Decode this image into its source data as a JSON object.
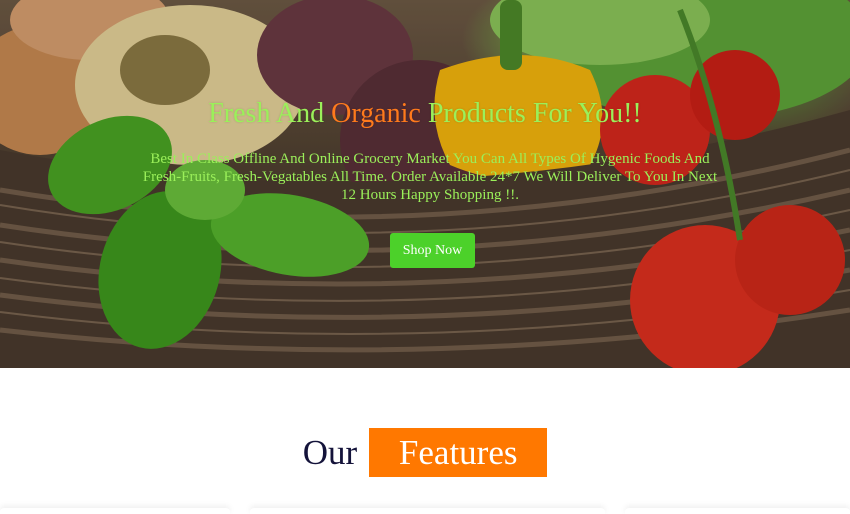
{
  "hero": {
    "title_part1": "Fresh And ",
    "title_accent": "Organic",
    "title_part2": " Products For You!!",
    "subtitle": "Best In Class Offline And Online Grocery Market You Can All Types Of Hygenic Foods And Fresh-Fruits, Fresh-Vegatables All Time. Order Available 24*7 We Will Deliver To You In Next 12 Hours Happy Shopping !!.",
    "button_label": "Shop Now"
  },
  "features": {
    "heading_word1": "Our",
    "heading_word2": "Features"
  },
  "colors": {
    "title_green": "#9bf05a",
    "accent_orange": "#ff7a1c",
    "button_green": "#4cd12a",
    "features_orange": "#ff7800",
    "navy_text": "#14133a"
  },
  "icons": [
    "vegetable-basket-background"
  ]
}
